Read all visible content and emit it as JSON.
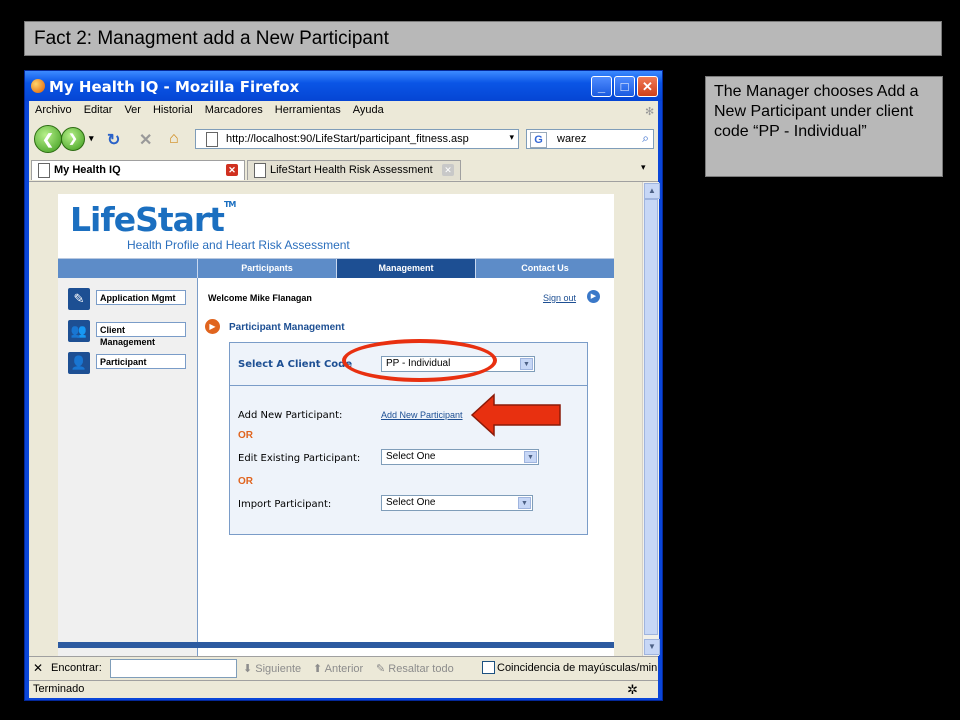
{
  "slide": {
    "title": "Fact 2: Managment add a New Participant",
    "note": "The Manager chooses Add a New Participant under client code “PP - Individual”"
  },
  "window": {
    "title": "My Health IQ - Mozilla Firefox",
    "menu": [
      "Archivo",
      "Editar",
      "Ver",
      "Historial",
      "Marcadores",
      "Herramientas",
      "Ayuda"
    ],
    "url": "http://localhost:90/LifeStart/participant_fitness.asp",
    "search_value": "warez",
    "tabs": [
      {
        "label": "My Health IQ",
        "active": true
      },
      {
        "label": "LifeStart Health Risk Assessment",
        "active": false
      }
    ],
    "find": {
      "label": "Encontrar:",
      "next": "Siguiente",
      "prev": "Anterior",
      "highlight": "Resaltar todo",
      "match_case": "Coincidencia de mayúsculas/minúsc"
    },
    "status": "Terminado"
  },
  "site": {
    "logo": "LifeStart",
    "logo_tm": "TM",
    "tagline": "Health Profile and Heart Risk Assessment",
    "nav": [
      "Participants",
      "Management",
      "Contact Us"
    ],
    "active_nav": "Management",
    "side_menu": [
      "Application Mgmt",
      "Client Management",
      "Participant"
    ],
    "welcome": "Welcome Mike Flanagan",
    "signout": "Sign out",
    "section_title": "Participant Management",
    "client_code_label": "Select A Client Code",
    "client_code_value": "PP - Individual",
    "add_label": "Add New Participant:",
    "add_link": "Add New Participant",
    "or": "OR",
    "edit_label": "Edit Existing Participant:",
    "edit_value": "Select One",
    "import_label": "Import Participant:",
    "import_value": "Select One"
  },
  "colors": {
    "accent": "#1d4f93",
    "nav_bg": "#5d8cc8",
    "highlight_red": "#e83010",
    "or_orange": "#e0641e"
  }
}
